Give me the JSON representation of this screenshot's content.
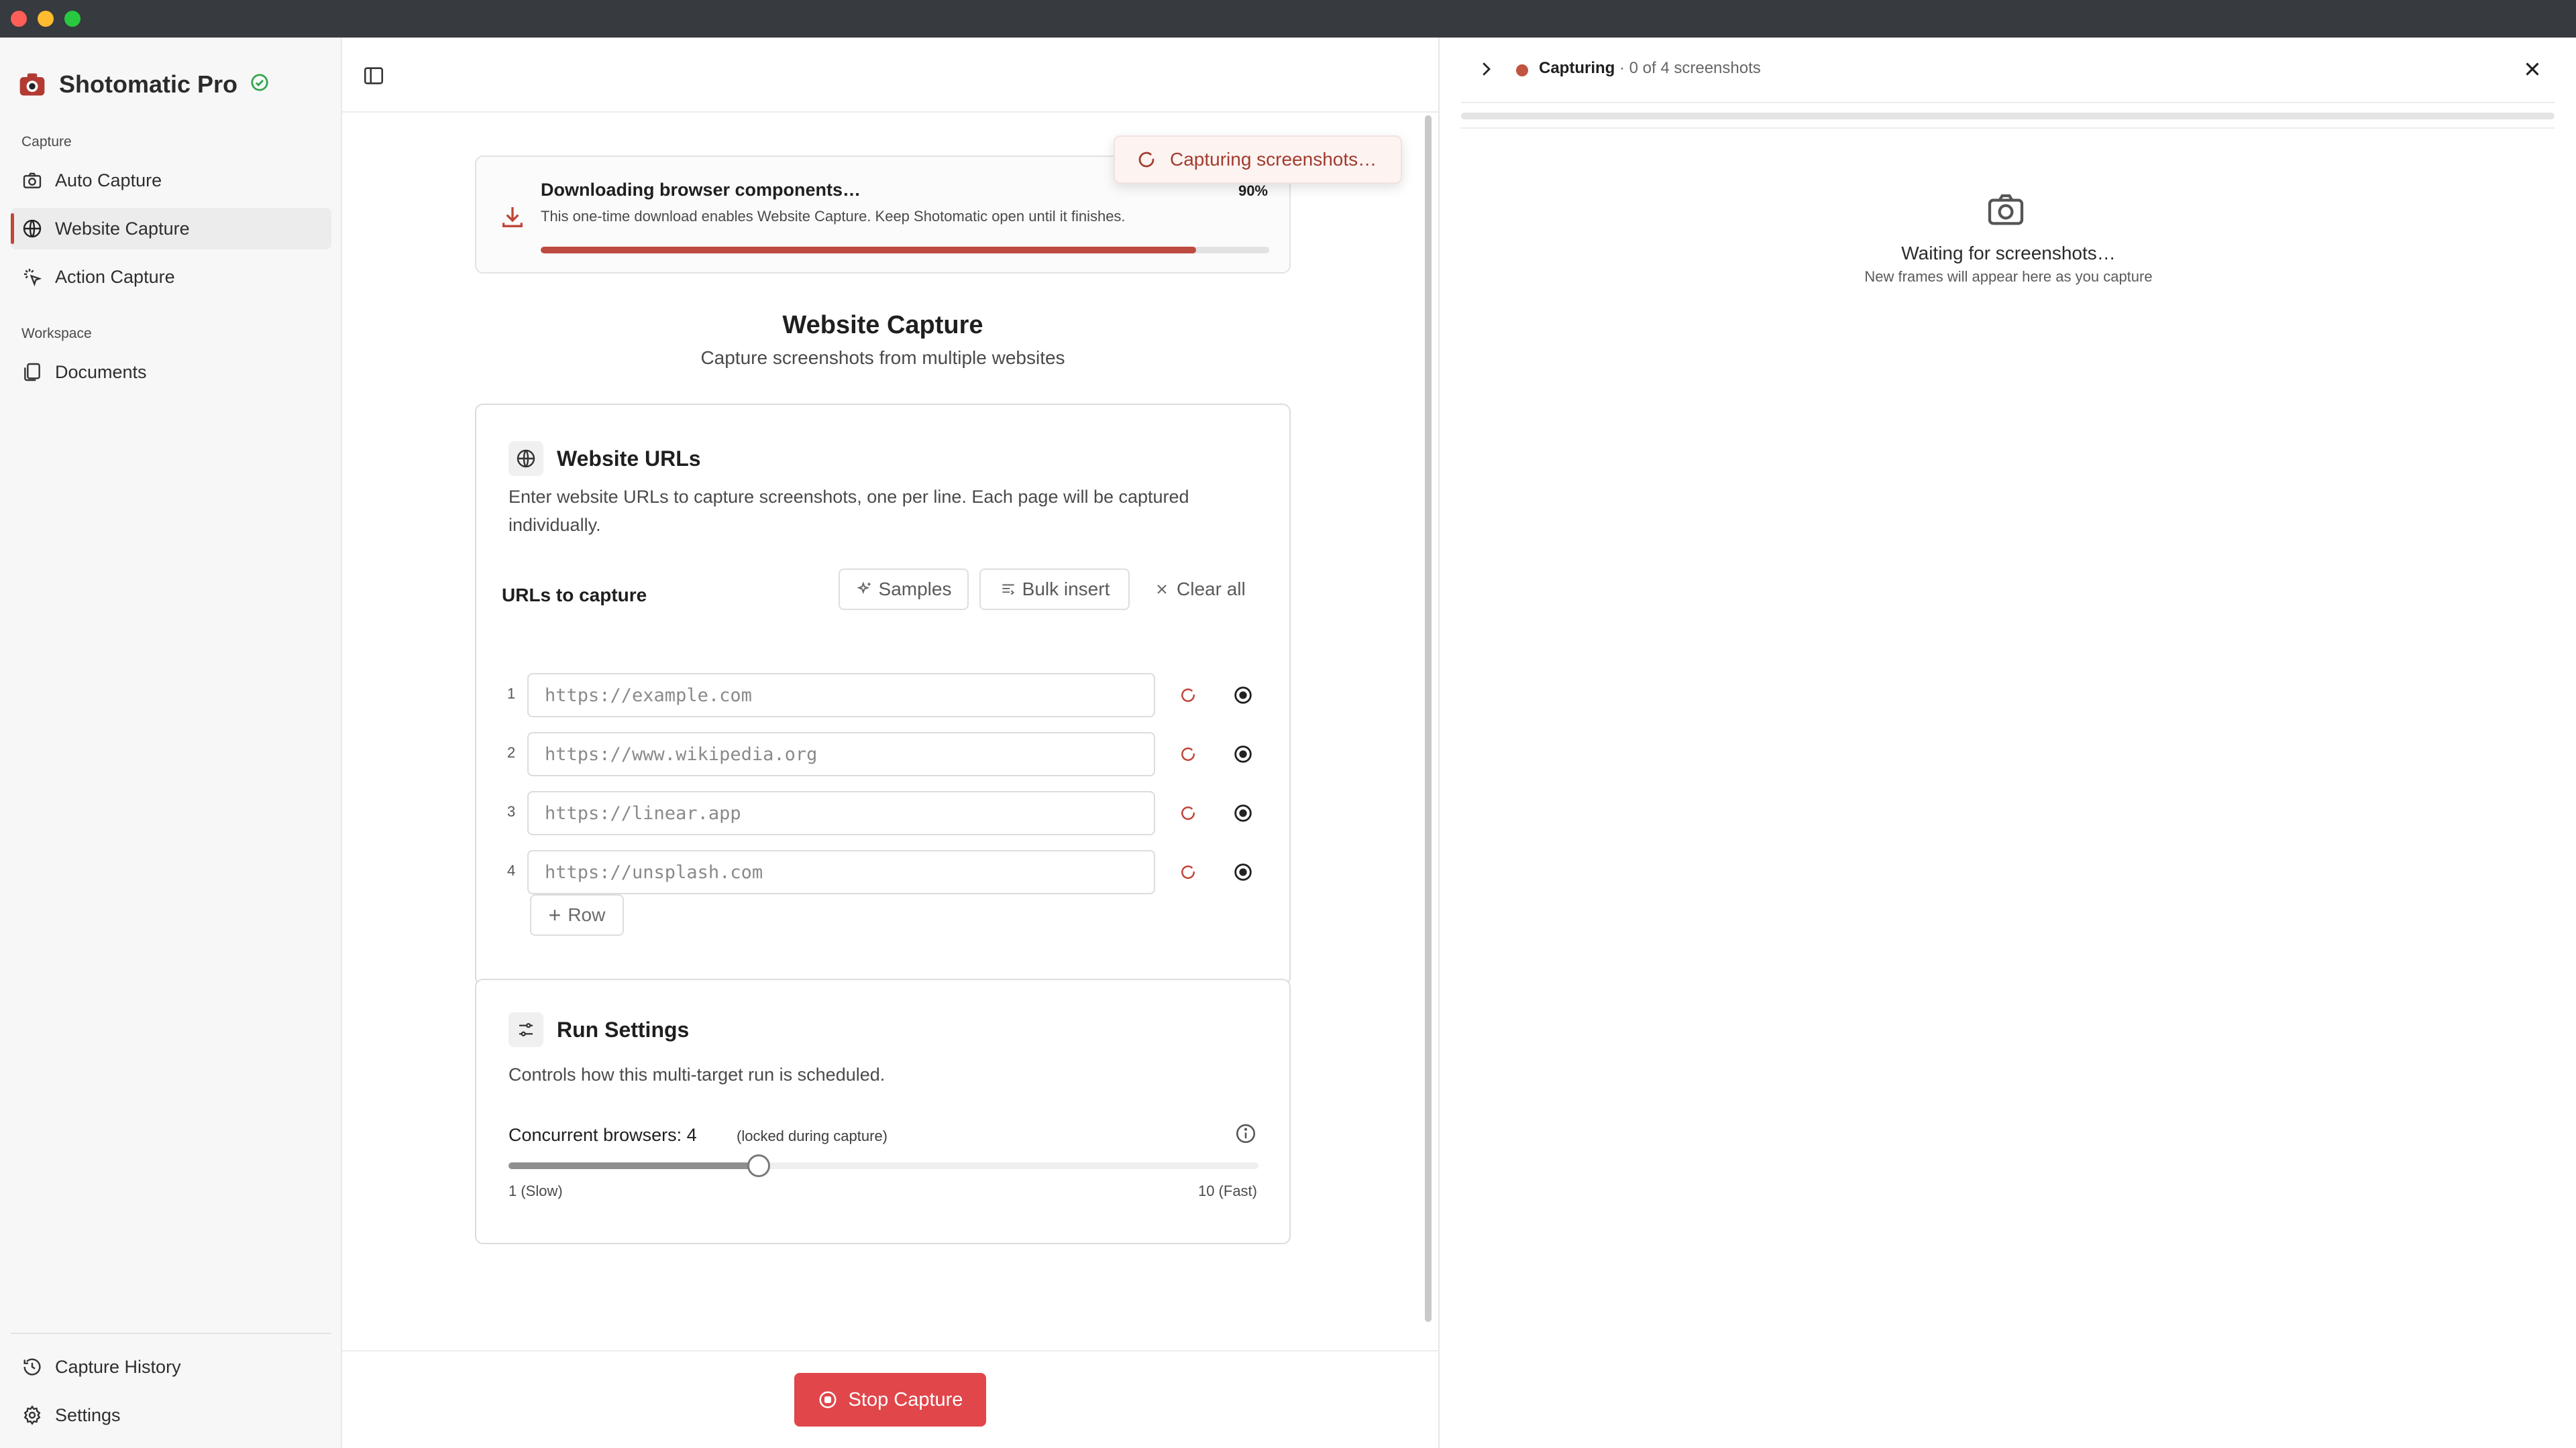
{
  "app": {
    "name": "Shotomatic Pro"
  },
  "sidebar": {
    "section_capture": "Capture",
    "items": [
      {
        "label": "Auto Capture",
        "icon": "camera-icon"
      },
      {
        "label": "Website Capture",
        "icon": "globe-icon",
        "active": true
      },
      {
        "label": "Action Capture",
        "icon": "sparkle-click-icon"
      }
    ],
    "section_workspace": "Workspace",
    "workspace_items": [
      {
        "label": "Documents",
        "icon": "documents-icon"
      }
    ],
    "bottom_items": [
      {
        "label": "Capture History",
        "icon": "history-icon"
      },
      {
        "label": "Settings",
        "icon": "gear-icon"
      }
    ]
  },
  "download": {
    "title": "Downloading browser components…",
    "subtitle": "This one-time download enables Website Capture. Keep Shotomatic open until it finishes.",
    "percent_label": "90%",
    "percent": 0.9
  },
  "toast": {
    "text": "Capturing screenshots…"
  },
  "page": {
    "title": "Website Capture",
    "subtitle": "Capture screenshots from multiple websites"
  },
  "urls_card": {
    "title": "Website URLs",
    "description": "Enter website URLs to capture screenshots, one per line. Each page will be captured individually.",
    "list_label": "URLs to capture",
    "samples_label": "Samples",
    "bulk_insert_label": "Bulk insert",
    "clear_all_label": "Clear all",
    "rows": [
      {
        "num": "1",
        "placeholder": "https://example.com"
      },
      {
        "num": "2",
        "placeholder": "https://www.wikipedia.org"
      },
      {
        "num": "3",
        "placeholder": "https://linear.app"
      },
      {
        "num": "4",
        "placeholder": "https://unsplash.com"
      }
    ],
    "add_row_label": "Row"
  },
  "run_card": {
    "title": "Run Settings",
    "description": "Controls how this multi-target run is scheduled.",
    "concurrency_label": "Concurrent browsers: 4",
    "concurrency_note": "(locked during capture)",
    "concurrency_value": 4,
    "concurrency_min": 1,
    "concurrency_max": 10,
    "min_label": "1 (Slow)",
    "max_label": "10 (Fast)"
  },
  "footer": {
    "stop_label": "Stop Capture"
  },
  "right_panel": {
    "status_strong": "Capturing",
    "status_detail": " · 0 of 4 screenshots",
    "waiting_title": "Waiting for screenshots…",
    "waiting_sub": "New frames will appear here as you capture"
  },
  "colors": {
    "accent": "#bd4a3f",
    "stop": "#e0464a",
    "ok": "#2fa64a"
  }
}
